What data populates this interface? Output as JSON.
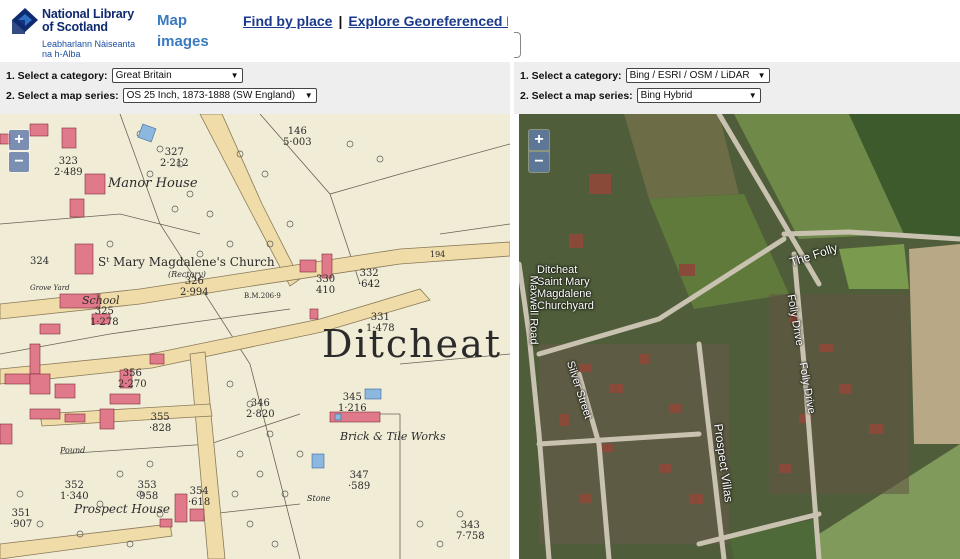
{
  "header": {
    "logo": {
      "line1": "National Library",
      "line2": "of Scotland",
      "gaelic1": "Leabharlann Nàiseanta",
      "gaelic2": "na h-Alba"
    },
    "title_line1": "Map",
    "title_line2": "images",
    "links": [
      {
        "label": "Find by place"
      },
      {
        "label": "Explore Georeferenced Maps"
      }
    ],
    "link_separator": "|"
  },
  "left_panel": {
    "category_label": "1. Select a category:",
    "category_value": "Great Britain",
    "series_label": "2. Select a map series:",
    "series_value": "OS 25 Inch, 1873-1888 (SW England)"
  },
  "right_panel": {
    "category_label": "1. Select a category:",
    "category_value": "Bing / ESRI / OSM / LiDAR",
    "series_label": "2. Select a map series:",
    "series_value": "Bing Hybrid"
  },
  "zoom": {
    "in": "+",
    "out": "−"
  },
  "left_map": {
    "labels": {
      "manor_house": "Manor House",
      "church": "Sᵗ Mary Magdalene's Church",
      "rectory": "(Rectory)",
      "school": "School",
      "ditcheat": "Ditcheat",
      "brick_works": "Brick & Tile Works",
      "prospect_house": "Prospect House",
      "pound": "Pound",
      "stone": "Stone",
      "grove_yard": "Grove Yard"
    },
    "parcels": [
      {
        "num": "146",
        "area": "5·003"
      },
      {
        "num": "327",
        "area": "2·212"
      },
      {
        "num": "323",
        "area": "2·489"
      },
      {
        "num": "324",
        "area": ""
      },
      {
        "num": "326",
        "area": "2·994"
      },
      {
        "num": "325",
        "area": "1·278"
      },
      {
        "num": "330",
        "area": "410"
      },
      {
        "num": "332",
        "area": "·642"
      },
      {
        "num": "331",
        "area": "1·478"
      },
      {
        "num": "356",
        "area": "2·270"
      },
      {
        "num": "355",
        "area": "·828"
      },
      {
        "num": "346",
        "area": "2·820"
      },
      {
        "num": "345",
        "area": "1·216"
      },
      {
        "num": "347",
        "area": "·589"
      },
      {
        "num": "353",
        "area": "·958"
      },
      {
        "num": "352",
        "area": "1·340"
      },
      {
        "num": "354",
        "area": "·618"
      },
      {
        "num": "351",
        "area": "·907"
      },
      {
        "num": "343",
        "area": "7·758"
      }
    ],
    "road_mark": "194",
    "bm_mark": "B.M.206·9"
  },
  "right_map": {
    "labels": {
      "the_folly": "The Folly",
      "church_line1": "Ditcheat",
      "church_line2": "Saint Mary",
      "church_line3": "Magdalene",
      "church_line4": "Churchyard",
      "maxwell_road": "Maxwell Road",
      "folly_drive1": "Folly Drive",
      "folly_drive2": "Folly Drive",
      "silver_street": "Silver Street",
      "prospect_villas": "Prospect Villas"
    }
  },
  "colors": {
    "link": "#1a3a8c",
    "title": "#3a7abf",
    "panel_bg": "#eeeeee",
    "paper": "#f1ecd6",
    "road": "#efdca8",
    "building_red": "#e07a8a",
    "water_blue": "#8cb8e0",
    "zoom": "#506ea0"
  }
}
